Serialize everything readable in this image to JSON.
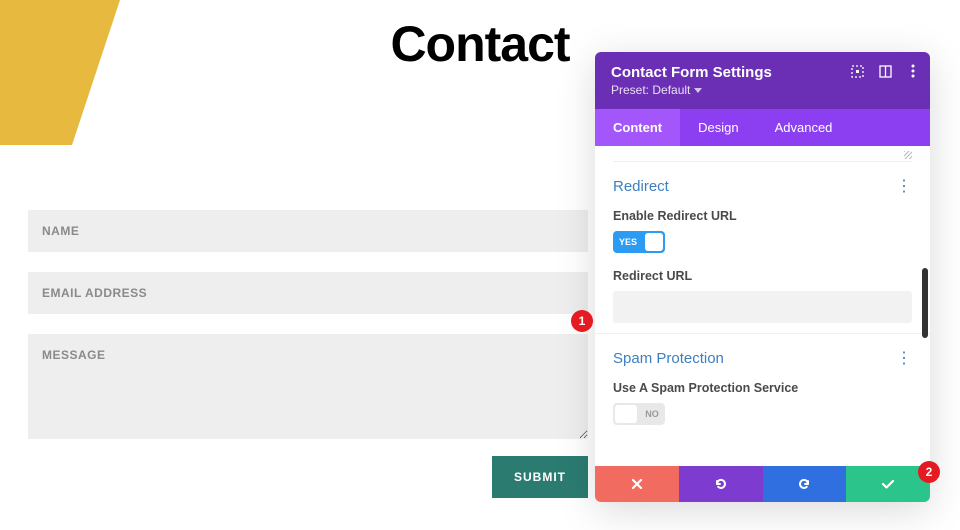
{
  "page": {
    "title": "Contact"
  },
  "form": {
    "name_placeholder": "NAME",
    "email_placeholder": "EMAIL ADDRESS",
    "message_placeholder": "MESSAGE",
    "submit_label": "SUBMIT"
  },
  "panel": {
    "title": "Contact Form Settings",
    "preset_label": "Preset: Default",
    "tabs": {
      "content": "Content",
      "design": "Design",
      "advanced": "Advanced"
    },
    "redirect": {
      "section_title": "Redirect",
      "enable_label": "Enable Redirect URL",
      "enable_value": "YES",
      "url_label": "Redirect URL",
      "url_value": ""
    },
    "spam": {
      "section_title": "Spam Protection",
      "service_label": "Use A Spam Protection Service",
      "service_value": "NO"
    }
  },
  "annotations": {
    "badge1": "1",
    "badge2": "2"
  }
}
